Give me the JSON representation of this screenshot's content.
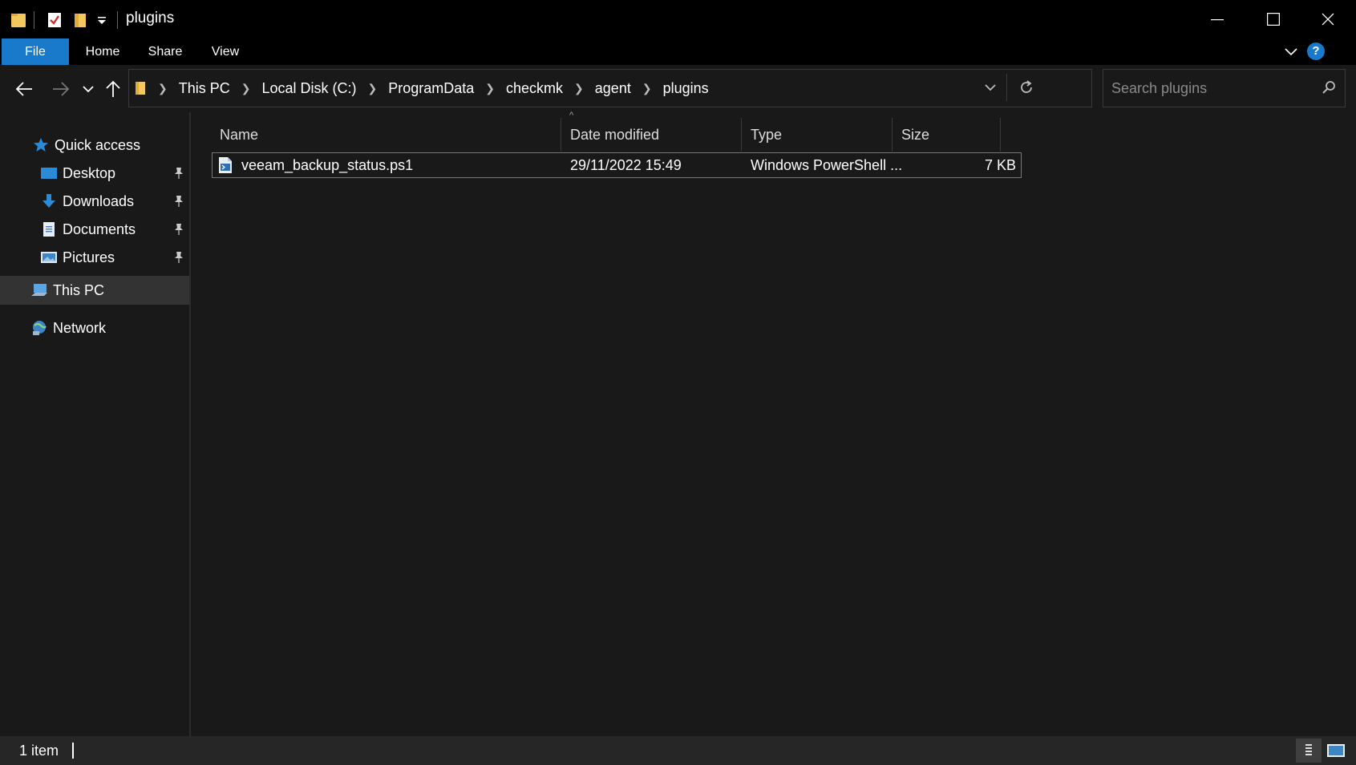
{
  "window": {
    "title": "plugins"
  },
  "ribbon": {
    "tabs": [
      "File",
      "Home",
      "Share",
      "View"
    ],
    "help_label": "?"
  },
  "address": {
    "crumbs": [
      "This PC",
      "Local Disk (C:)",
      "ProgramData",
      "checkmk",
      "agent",
      "plugins"
    ]
  },
  "search": {
    "placeholder": "Search plugins"
  },
  "nav": {
    "quick_access": "Quick access",
    "items": [
      "Desktop",
      "Downloads",
      "Documents",
      "Pictures"
    ],
    "this_pc": "This PC",
    "network": "Network"
  },
  "columns": [
    "Name",
    "Date modified",
    "Type",
    "Size"
  ],
  "files": [
    {
      "name": "veeam_backup_status.ps1",
      "date": "29/11/2022 15:49",
      "type": "Windows PowerShell ...",
      "size": "7 KB"
    }
  ],
  "status": {
    "count": "1 item"
  },
  "colors": {
    "accent": "#1979ca",
    "background": "#191919"
  }
}
